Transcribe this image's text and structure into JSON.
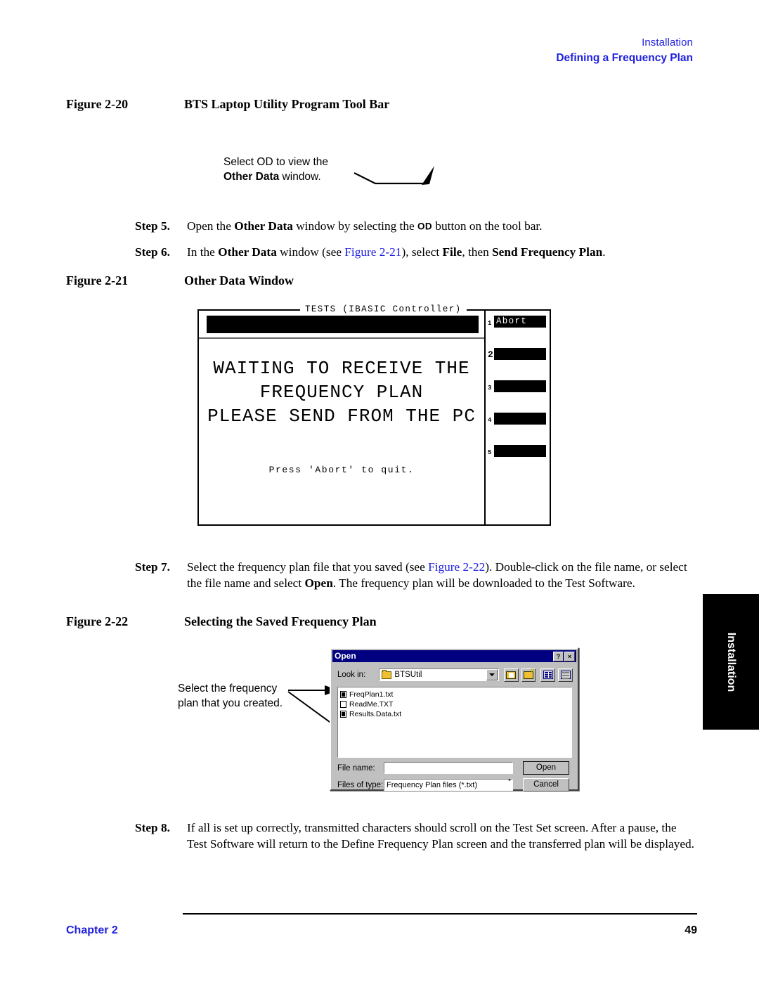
{
  "header": {
    "line1": "Installation",
    "line2": "Defining a Frequency Plan",
    "color": "#2020e0"
  },
  "figures": {
    "fig20": {
      "number": "Figure 2-20",
      "title": "BTS Laptop Utility Program Tool Bar"
    },
    "fig21": {
      "number": "Figure 2-21",
      "title": "Other Data Window"
    },
    "fig22": {
      "number": "Figure 2-22",
      "title": "Selecting the Saved Frequency Plan"
    }
  },
  "callouts": {
    "od": {
      "line1": "Select OD to view the",
      "line2_bold": "Other Data",
      "line2_rest": " window."
    },
    "freqplan": {
      "line1": "Select the frequency",
      "line2": "plan that you created."
    }
  },
  "steps": {
    "step5": {
      "label": "Step 5.",
      "t1": "Open the ",
      "b1": "Other Data",
      "t2": " window by selecting the ",
      "od": "OD",
      "t3": " button on the tool bar."
    },
    "step6": {
      "label": "Step 6.",
      "t1": "In the ",
      "b1": "Other Data",
      "t2": " window (see ",
      "link": "Figure 2-21",
      "t3": "), select ",
      "b2": "File",
      "t4": ", then ",
      "b3": "Send Frequency Plan",
      "t5": "."
    },
    "step7": {
      "label": "Step 7.",
      "t1": "Select the frequency plan file that you saved (see ",
      "link": "Figure 2-22",
      "t2": "). Double-click on the file name, or select the file name and select ",
      "b1": "Open",
      "t3": ". The frequency plan will be downloaded to the Test Software."
    },
    "step8": {
      "label": "Step 8.",
      "t1": "If all is set up correctly, transmitted characters should scroll on the Test Set screen. After a pause, the Test Software will return to the Define Frequency Plan screen and the transferred plan will be displayed."
    }
  },
  "testset": {
    "title": "TESTS (IBASIC Controller)",
    "message": "WAITING TO RECEIVE THE\nFREQUENCY PLAN\nPLEASE SEND FROM THE PC",
    "press_hint": "Press 'Abort' to quit.",
    "softkeys": [
      {
        "num": "1",
        "label": "Abort"
      },
      {
        "num": "2",
        "label": ""
      },
      {
        "num": "3",
        "label": ""
      },
      {
        "num": "4",
        "label": ""
      },
      {
        "num": "5",
        "label": ""
      }
    ]
  },
  "open_dialog": {
    "title": "Open",
    "help_button": "?",
    "close_button": "×",
    "lookin_label": "Look in:",
    "lookin_value": "BTSUtil",
    "toolbar_icons": [
      "up-one-level-icon",
      "new-folder-icon",
      "list-view-icon",
      "details-view-icon"
    ],
    "files": [
      {
        "name": "FreqPlan1.txt",
        "icon": "text-file-icon"
      },
      {
        "name": "ReadMe.TXT",
        "icon": "text-file-icon"
      },
      {
        "name": "Results.Data.txt",
        "icon": "text-file-icon"
      }
    ],
    "filename_label": "File name:",
    "filename_value": "",
    "filetype_label": "Files of type:",
    "filetype_value": "Frequency Plan files (*.txt)",
    "open_button": "Open",
    "cancel_button": "Cancel"
  },
  "side_tab": {
    "label": "Installation"
  },
  "footer": {
    "chapter": "Chapter 2",
    "page": "49",
    "chapter_color": "#2020e0"
  }
}
